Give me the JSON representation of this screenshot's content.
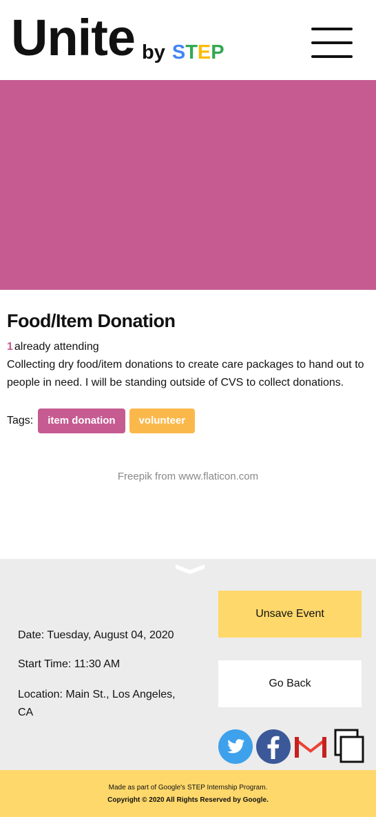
{
  "header": {
    "logo_main": "Unite",
    "logo_by": "by",
    "logo_step_letters": [
      "S",
      "T",
      "E",
      "P"
    ]
  },
  "banner": {
    "color": "#c55b91"
  },
  "event": {
    "title": "Food/Item Donation",
    "attending_count": "1",
    "attending_text": "already attending",
    "description": "Collecting dry food/item donations to create care packages to hand out to people in need. I will be standing outside of CVS to collect donations.",
    "tags_label": "Tags:",
    "tags": [
      {
        "label": "item donation",
        "color": "#c55b91"
      },
      {
        "label": "volunteer",
        "color": "#fbb84a"
      }
    ],
    "image_credit": "Freepik from www.flaticon.com"
  },
  "details": {
    "date": "Date: Tuesday, August 04, 2020",
    "start_time": "Start Time: 11:30 AM",
    "location": "Location: Main St., Los Angeles, CA"
  },
  "actions": {
    "unsave_label": "Unsave Event",
    "back_label": "Go Back"
  },
  "share_icons": [
    "twitter-icon",
    "facebook-icon",
    "gmail-icon",
    "copy-link-icon"
  ],
  "footer": {
    "line1": "Made as part of Google's STEP Internship Program.",
    "line2": "Copyright © 2020 All Rights Reserved by Google."
  },
  "colors": {
    "accent_pink": "#c55b91",
    "accent_yellow": "#fed86b",
    "tag_orange": "#fbb84a",
    "details_bg": "#ececec"
  }
}
